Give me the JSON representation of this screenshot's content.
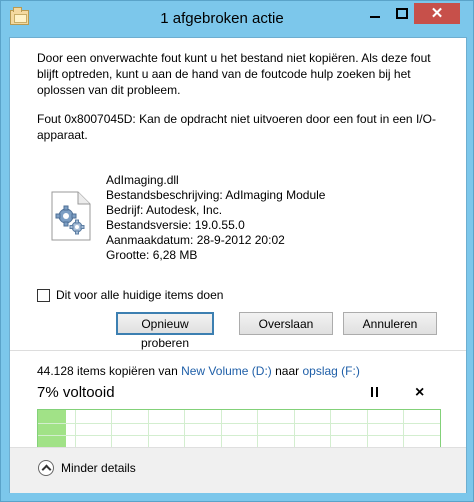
{
  "window": {
    "title": "1 afgebroken actie",
    "controls": {
      "minimize_icon": "minimize-icon",
      "maximize_icon": "maximize-icon",
      "close_label": "✕"
    }
  },
  "message": {
    "intro": "Door een onverwachte fout kunt u het bestand niet kopiëren. Als deze fout blijft optreden, kunt u aan de hand van de foutcode hulp zoeken bij het oplossen van dit probleem.",
    "error": "Fout 0x8007045D: Kan de opdracht niet uitvoeren door een fout in een I/O-apparaat."
  },
  "file": {
    "icon": "dll-gear-file-icon",
    "name": "AdImaging.dll",
    "description": "Bestandsbeschrijving: AdImaging Module",
    "company": "Bedrijf: Autodesk, Inc.",
    "version": "Bestandsversie: 19.0.55.0",
    "created": "Aanmaakdatum: 28-9-2012 20:02",
    "size": "Grootte: 6,28 MB"
  },
  "checkbox": {
    "label": "Dit voor alle huidige items doen",
    "checked": false
  },
  "buttons": {
    "retry": "Opnieuw proberen",
    "skip": "Overslaan",
    "cancel": "Annuleren"
  },
  "progress": {
    "count_text": "44.128 items kopiëren van ",
    "source": "New Volume (D:)",
    "middle": " naar ",
    "destination": "opslag (F:)",
    "status": "7% voltooid",
    "percent_value": 7,
    "pause_icon": "pause-icon",
    "close_label": "×"
  },
  "footer": {
    "less_details": "Minder details",
    "icon": "chevron-up-icon"
  },
  "colors": {
    "accent": "#7cc7eb",
    "close": "#c7504a",
    "graph_fill": "#a1e287",
    "link": "#1f5fa8"
  }
}
